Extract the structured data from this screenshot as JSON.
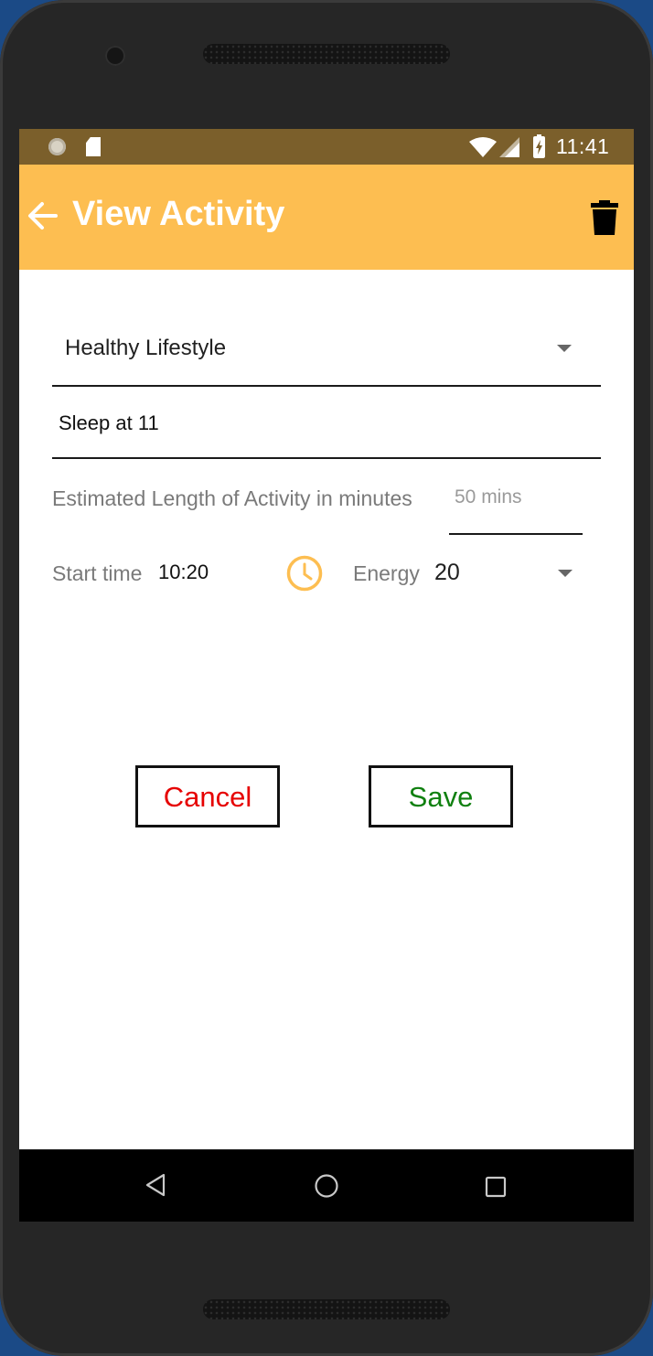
{
  "status_bar": {
    "time": "11:41",
    "icons": [
      "notification-circle-icon",
      "sd-card-icon",
      "wifi-icon",
      "signal-icon",
      "battery-charging-icon"
    ]
  },
  "app_bar": {
    "title": "View Activity",
    "back_icon": "arrow-back-icon",
    "delete_icon": "trash-icon",
    "color": "#fdbe51"
  },
  "form": {
    "category": {
      "selected": "Healthy Lifestyle"
    },
    "activity_name": {
      "value": "Sleep at 11"
    },
    "length": {
      "label": "Estimated Length of Activity in minutes",
      "placeholder": "50 mins"
    },
    "start_time": {
      "label": "Start time",
      "value": "10:20",
      "icon": "clock-icon"
    },
    "energy": {
      "label": "Energy",
      "selected": "20"
    }
  },
  "buttons": {
    "cancel": {
      "label": "Cancel",
      "color": "#e60000"
    },
    "save": {
      "label": "Save",
      "color": "#108010"
    }
  },
  "nav_bar": {
    "icons": [
      "nav-back-icon",
      "nav-home-icon",
      "nav-recents-icon"
    ]
  }
}
